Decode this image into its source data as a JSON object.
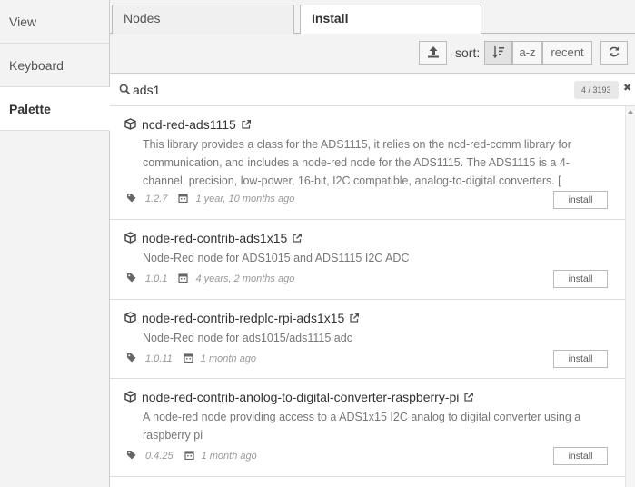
{
  "sidebar": {
    "items": [
      {
        "label": "View"
      },
      {
        "label": "Keyboard"
      },
      {
        "label": "Palette"
      }
    ]
  },
  "tabs": {
    "nodes": "Nodes",
    "install": "Install"
  },
  "toolbar": {
    "sort_label": "sort:",
    "az_label": "a-z",
    "recent_label": "recent"
  },
  "search": {
    "value": "ads1",
    "count": "4 / 3193",
    "clear": "✖"
  },
  "results": [
    {
      "name": "ncd-red-ads1115",
      "description": "This library provides a class for the ADS1115, it relies on the ncd-red-comm library for communication, and includes a node-red node for the ADS1115. The ADS1115 is a 4-channel, precision, low-power, 16-bit, I2C compatible, analog-to-digital converters. [",
      "version": "1.2.7",
      "updated": "1 year, 10 months ago",
      "install_label": "install"
    },
    {
      "name": "node-red-contrib-ads1x15",
      "description": "Node-Red node for ADS1015 and ADS1115 I2C ADC",
      "version": "1.0.1",
      "updated": "4 years, 2 months ago",
      "install_label": "install"
    },
    {
      "name": "node-red-contrib-redplc-rpi-ads1x15",
      "description": "Node-Red node for ads1015/ads1115 adc",
      "version": "1.0.11",
      "updated": "1 month ago",
      "install_label": "install"
    },
    {
      "name": "node-red-contrib-anolog-to-digital-converter-raspberry-pi",
      "description": "A node-red node providing access to a ADS1x15 I2C analog to digital converter using a raspberry pi",
      "version": "0.4.25",
      "updated": "1 month ago",
      "install_label": "install"
    }
  ]
}
